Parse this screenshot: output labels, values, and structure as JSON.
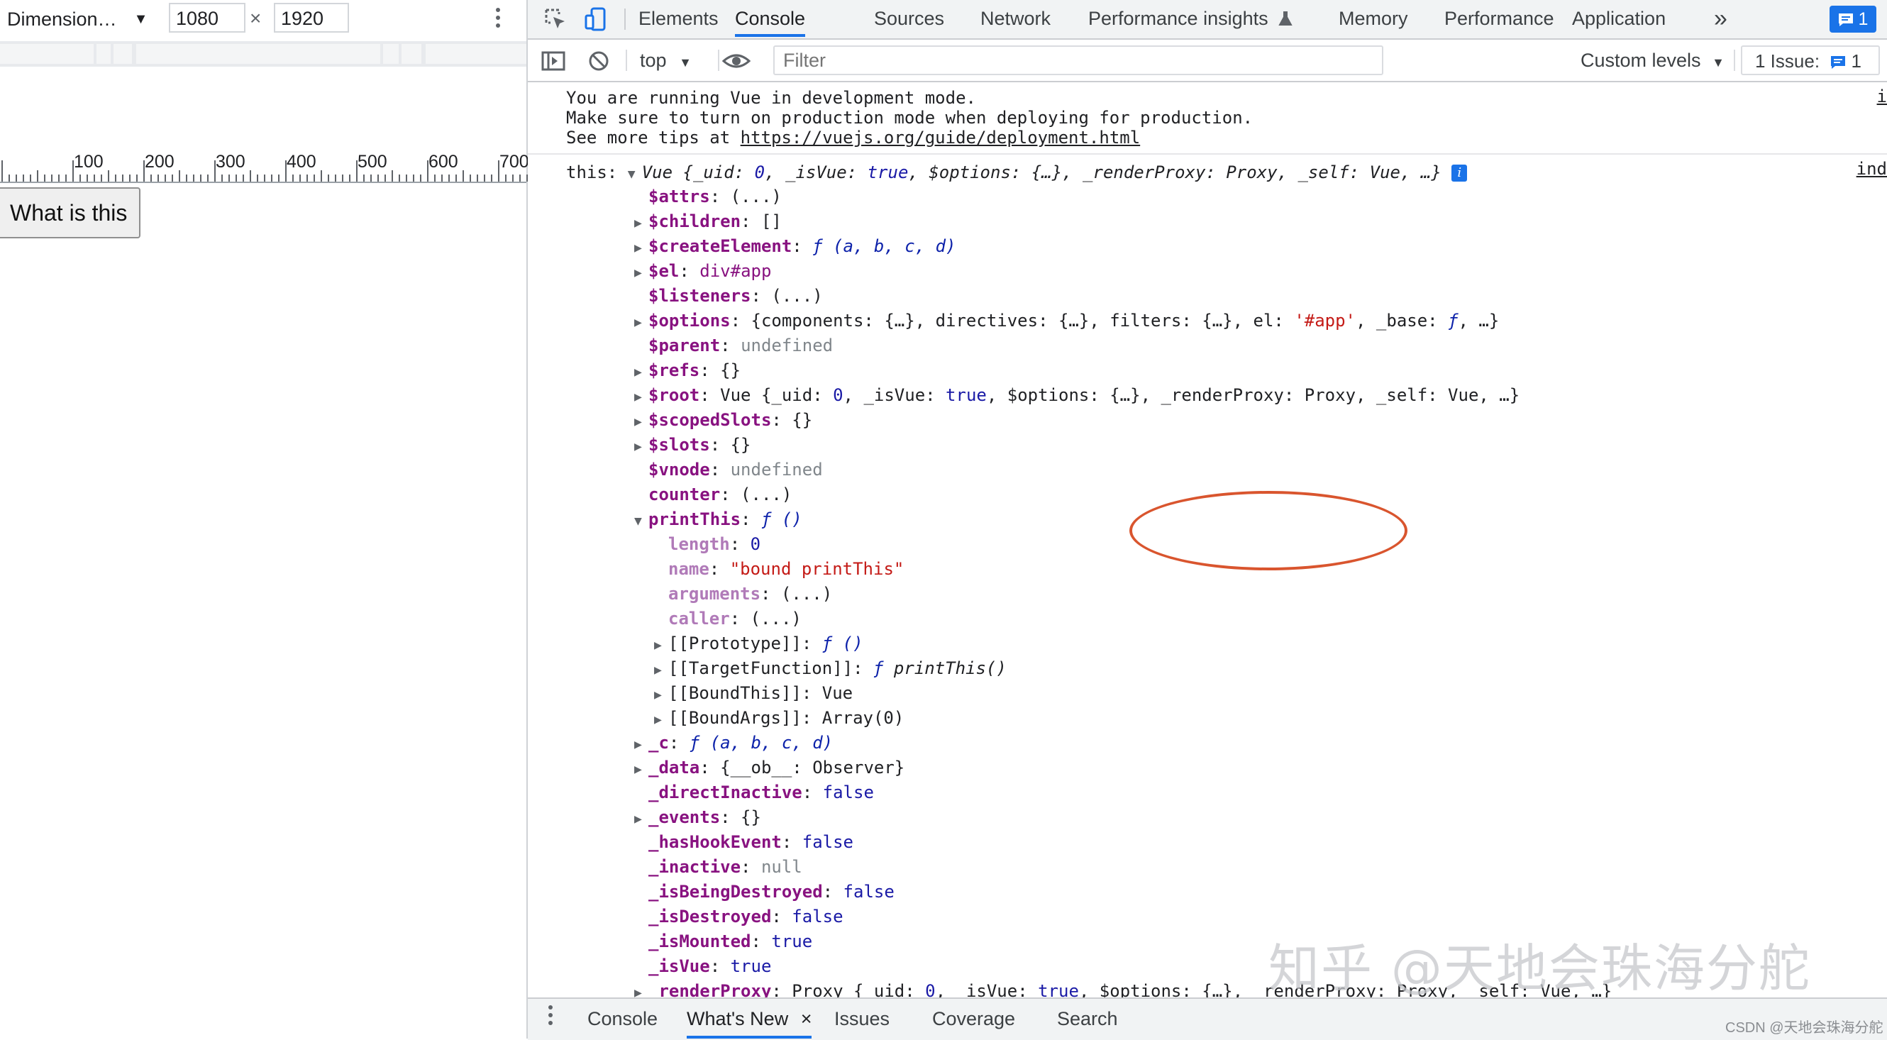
{
  "device_toolbar": {
    "device": "Dimension…",
    "width": "1080",
    "height": "1920",
    "times": "×"
  },
  "ruler": [
    "100",
    "200",
    "300",
    "400",
    "500",
    "600",
    "700"
  ],
  "page": {
    "button_label": "What is this"
  },
  "devtools": {
    "tabs": [
      "Elements",
      "Console",
      "Sources",
      "Network",
      "Performance insights",
      "Memory",
      "Performance",
      "Application"
    ],
    "more_tabs": "»",
    "message_badge": "1",
    "toolbar": {
      "context": "top",
      "filter_placeholder": "Filter",
      "levels": "Custom levels",
      "issues": "1 Issue:",
      "issues_count": "1"
    },
    "vue_message": {
      "line1": "You are running Vue in development mode.",
      "line2": "Make sure to turn on production mode when deploying for production.",
      "line3_prefix": "See more tips at ",
      "link": "https://vuejs.org/guide/deployment.html",
      "source": "i"
    },
    "object_source": "ind",
    "drawer_tabs": [
      "Console",
      "What's New",
      "Issues",
      "Coverage",
      "Search"
    ],
    "close_glyph": "×"
  },
  "watermark": "知乎 @天地会珠海分舵",
  "credit": "CSDN @天地会珠海分舵",
  "colors": {
    "accent": "#1a73e8",
    "annotation": "#d9552e",
    "property": "#881280",
    "string": "#c41a16",
    "number": "#1a1aa6"
  }
}
